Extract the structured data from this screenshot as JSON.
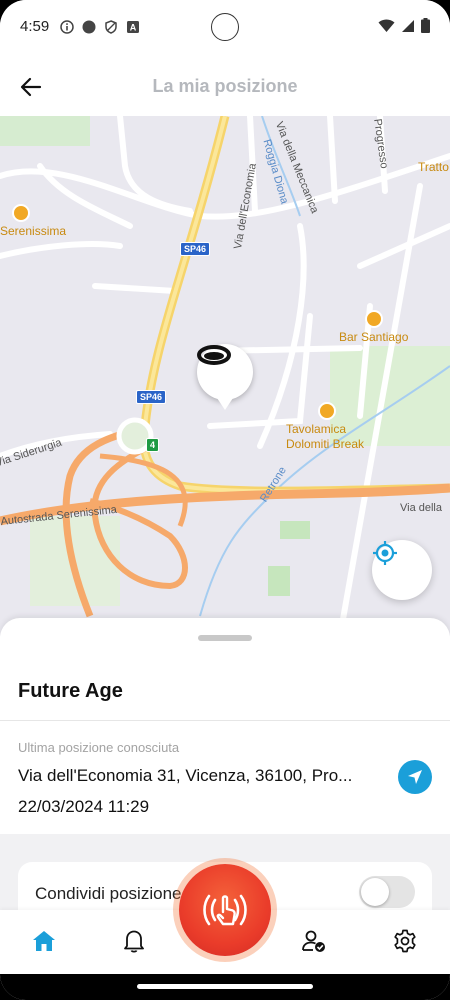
{
  "status_bar": {
    "time": "4:59",
    "left_icons": [
      "info-circle-icon",
      "dot-icon",
      "shield-icon",
      "a-icon"
    ],
    "right_icons": [
      "wifi-icon",
      "signal-icon",
      "battery-icon"
    ]
  },
  "header": {
    "title": "La mia posizione",
    "back_icon": "arrow-left-icon"
  },
  "map": {
    "street_labels": [
      "Via della Meccanica",
      "Progresso",
      "Roggia Diona",
      "Via dell'Economia",
      "Via Siderurgia",
      "Autostrada Serenissima",
      "Retrone",
      "Via della"
    ],
    "road_shields": [
      "SP46",
      "SP46",
      "4"
    ],
    "pois": [
      "Bar Santiago",
      "Tavolamica Dolomiti Break",
      "Serenissima",
      "Tratto"
    ],
    "marker_icon": "wristband-icon",
    "locate_icon": "crosshair-icon"
  },
  "sheet": {
    "device_name": "Future Age",
    "last_position_label": "Ultima posizione conosciuta",
    "address": "Via dell'Economia 31, Vicenza, 36100, Pro...",
    "timestamp": "22/03/2024 11:29",
    "navigate_icon": "navigation-arrow-icon",
    "share_label": "Condividi posizione",
    "share_enabled": false
  },
  "bottom_nav": {
    "items": [
      "home-icon",
      "bell-icon",
      "sos-hand-icon",
      "user-check-icon",
      "gear-icon"
    ],
    "active": "home-icon"
  },
  "colors": {
    "accent": "#1b9fd9",
    "sos": "#ea3c2a",
    "title_grey": "#b5b8bd"
  }
}
